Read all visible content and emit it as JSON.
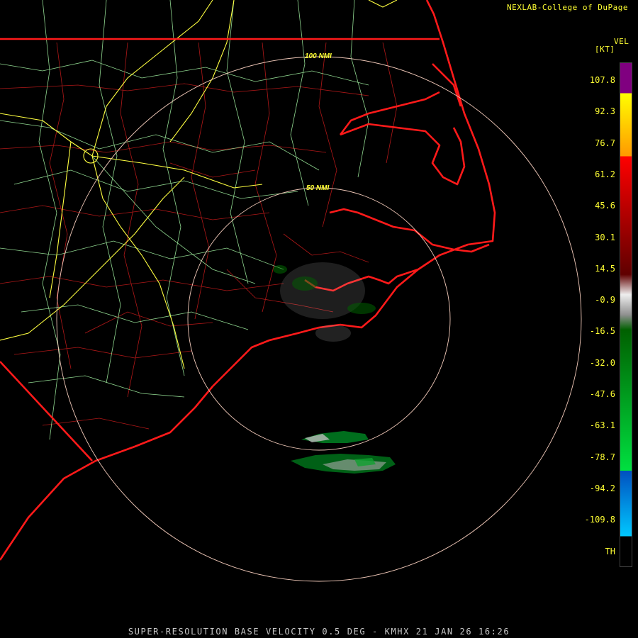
{
  "header": {
    "credit": "NEXLAB-College of DuPage",
    "product_code": "VEL",
    "unit": "[KT]"
  },
  "footer": {
    "caption": "SUPER-RESOLUTION BASE VELOCITY 0.5 DEG - KMHX 21 JAN 26 16:26"
  },
  "range_rings": [
    {
      "label": "100 NMI",
      "value": 100
    },
    {
      "label": "50 NMI",
      "value": 50
    }
  ],
  "color_scale": {
    "labels": [
      "107.8",
      "92.3",
      "76.7",
      "61.2",
      "45.6",
      "30.1",
      "14.5",
      "-0.9",
      "-16.5",
      "-32.0",
      "-47.6",
      "-63.1",
      "-78.7",
      "-94.2",
      "-109.8",
      "TH"
    ],
    "colors": {
      "purple": "#800080",
      "yellow": "#ffff00",
      "orange": "#ff9900",
      "red": "#ff0000",
      "dark_red": "#600000",
      "gray": "#909090",
      "dark_green": "#006000",
      "green": "#00e040",
      "blue": "#0050c0",
      "light_blue": "#00c8ff"
    }
  },
  "map_colors": {
    "state_border": "#ff1a1a",
    "coastline": "#ff1a1a",
    "county_lines": "#b01818",
    "highways": "#90d890",
    "interstates": "#ffff40",
    "range_rings": "#f0c8b8"
  }
}
